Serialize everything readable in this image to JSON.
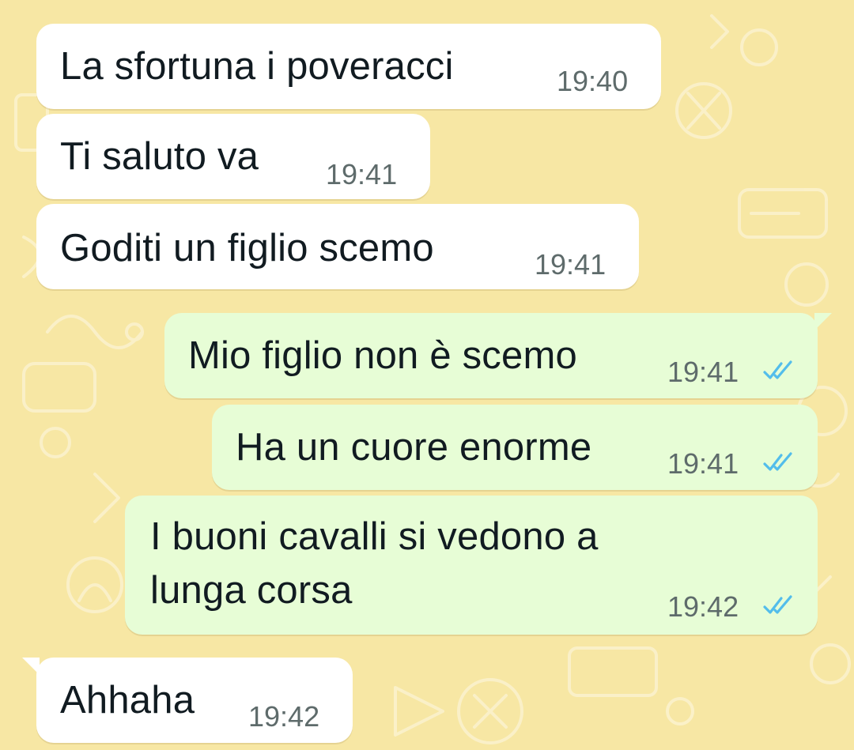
{
  "colors": {
    "wallpaper": "#f7e7a4",
    "incoming_bubble": "#ffffff",
    "outgoing_bubble": "#e7fdd6",
    "read_ticks": "#53bdeb",
    "time_text": "#5e6b6b"
  },
  "messages": [
    {
      "direction": "incoming",
      "text": "La sfortuna i poveracci",
      "time": "19:40"
    },
    {
      "direction": "incoming",
      "text": "Ti saluto va",
      "time": "19:41"
    },
    {
      "direction": "incoming",
      "text": "Goditi un figlio scemo",
      "time": "19:41"
    },
    {
      "direction": "outgoing",
      "text": "Mio figlio non è scemo",
      "time": "19:41",
      "status": "read",
      "status_icon": "double-check-icon"
    },
    {
      "direction": "outgoing",
      "text": "Ha un cuore enorme",
      "time": "19:41",
      "status": "read",
      "status_icon": "double-check-icon"
    },
    {
      "direction": "outgoing",
      "text_lines": [
        "I buoni cavalli si vedono a",
        "lunga corsa"
      ],
      "time": "19:42",
      "status": "read",
      "status_icon": "double-check-icon"
    },
    {
      "direction": "incoming",
      "text": "Ahhaha",
      "time": "19:42"
    }
  ]
}
